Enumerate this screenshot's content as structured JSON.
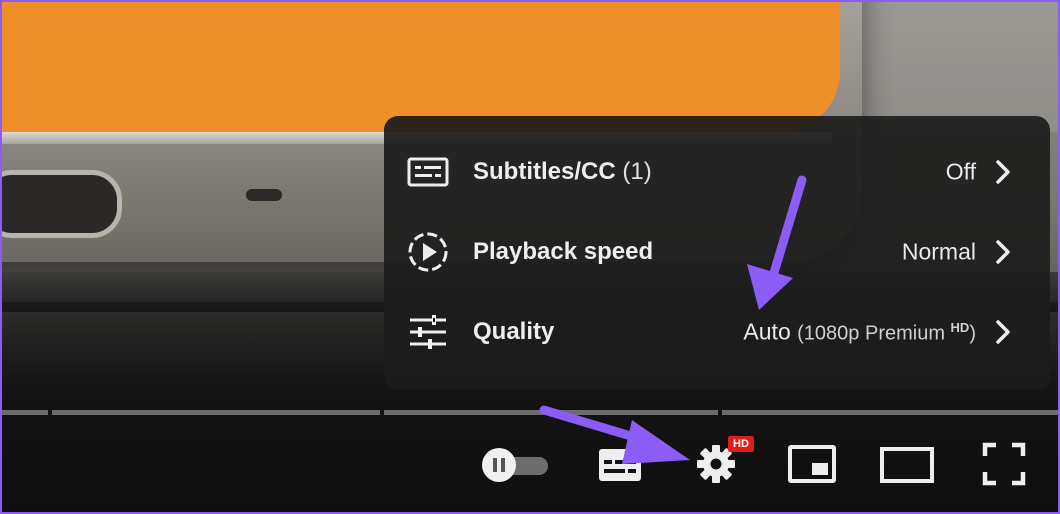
{
  "settings_menu": {
    "items": [
      {
        "icon": "subtitles-icon",
        "label": "Subtitles/CC",
        "count": "(1)",
        "value": "Off",
        "detail": "",
        "badge": ""
      },
      {
        "icon": "playback-speed-icon",
        "label": "Playback speed",
        "count": "",
        "value": "Normal",
        "detail": "",
        "badge": ""
      },
      {
        "icon": "quality-sliders-icon",
        "label": "Quality",
        "count": "",
        "value": "Auto",
        "detail": "(1080p Premium",
        "badge": "HD",
        "detail_close": ")"
      }
    ]
  },
  "controls": {
    "settings_badge": "HD",
    "autoplay_on": false
  },
  "progress_segments": 4,
  "colors": {
    "menu_bg": "#1c1c1c",
    "annotation_arrow": "#8b5cf6",
    "hd_badge": "#e01b1b",
    "video_accent": "#f08f2a"
  }
}
